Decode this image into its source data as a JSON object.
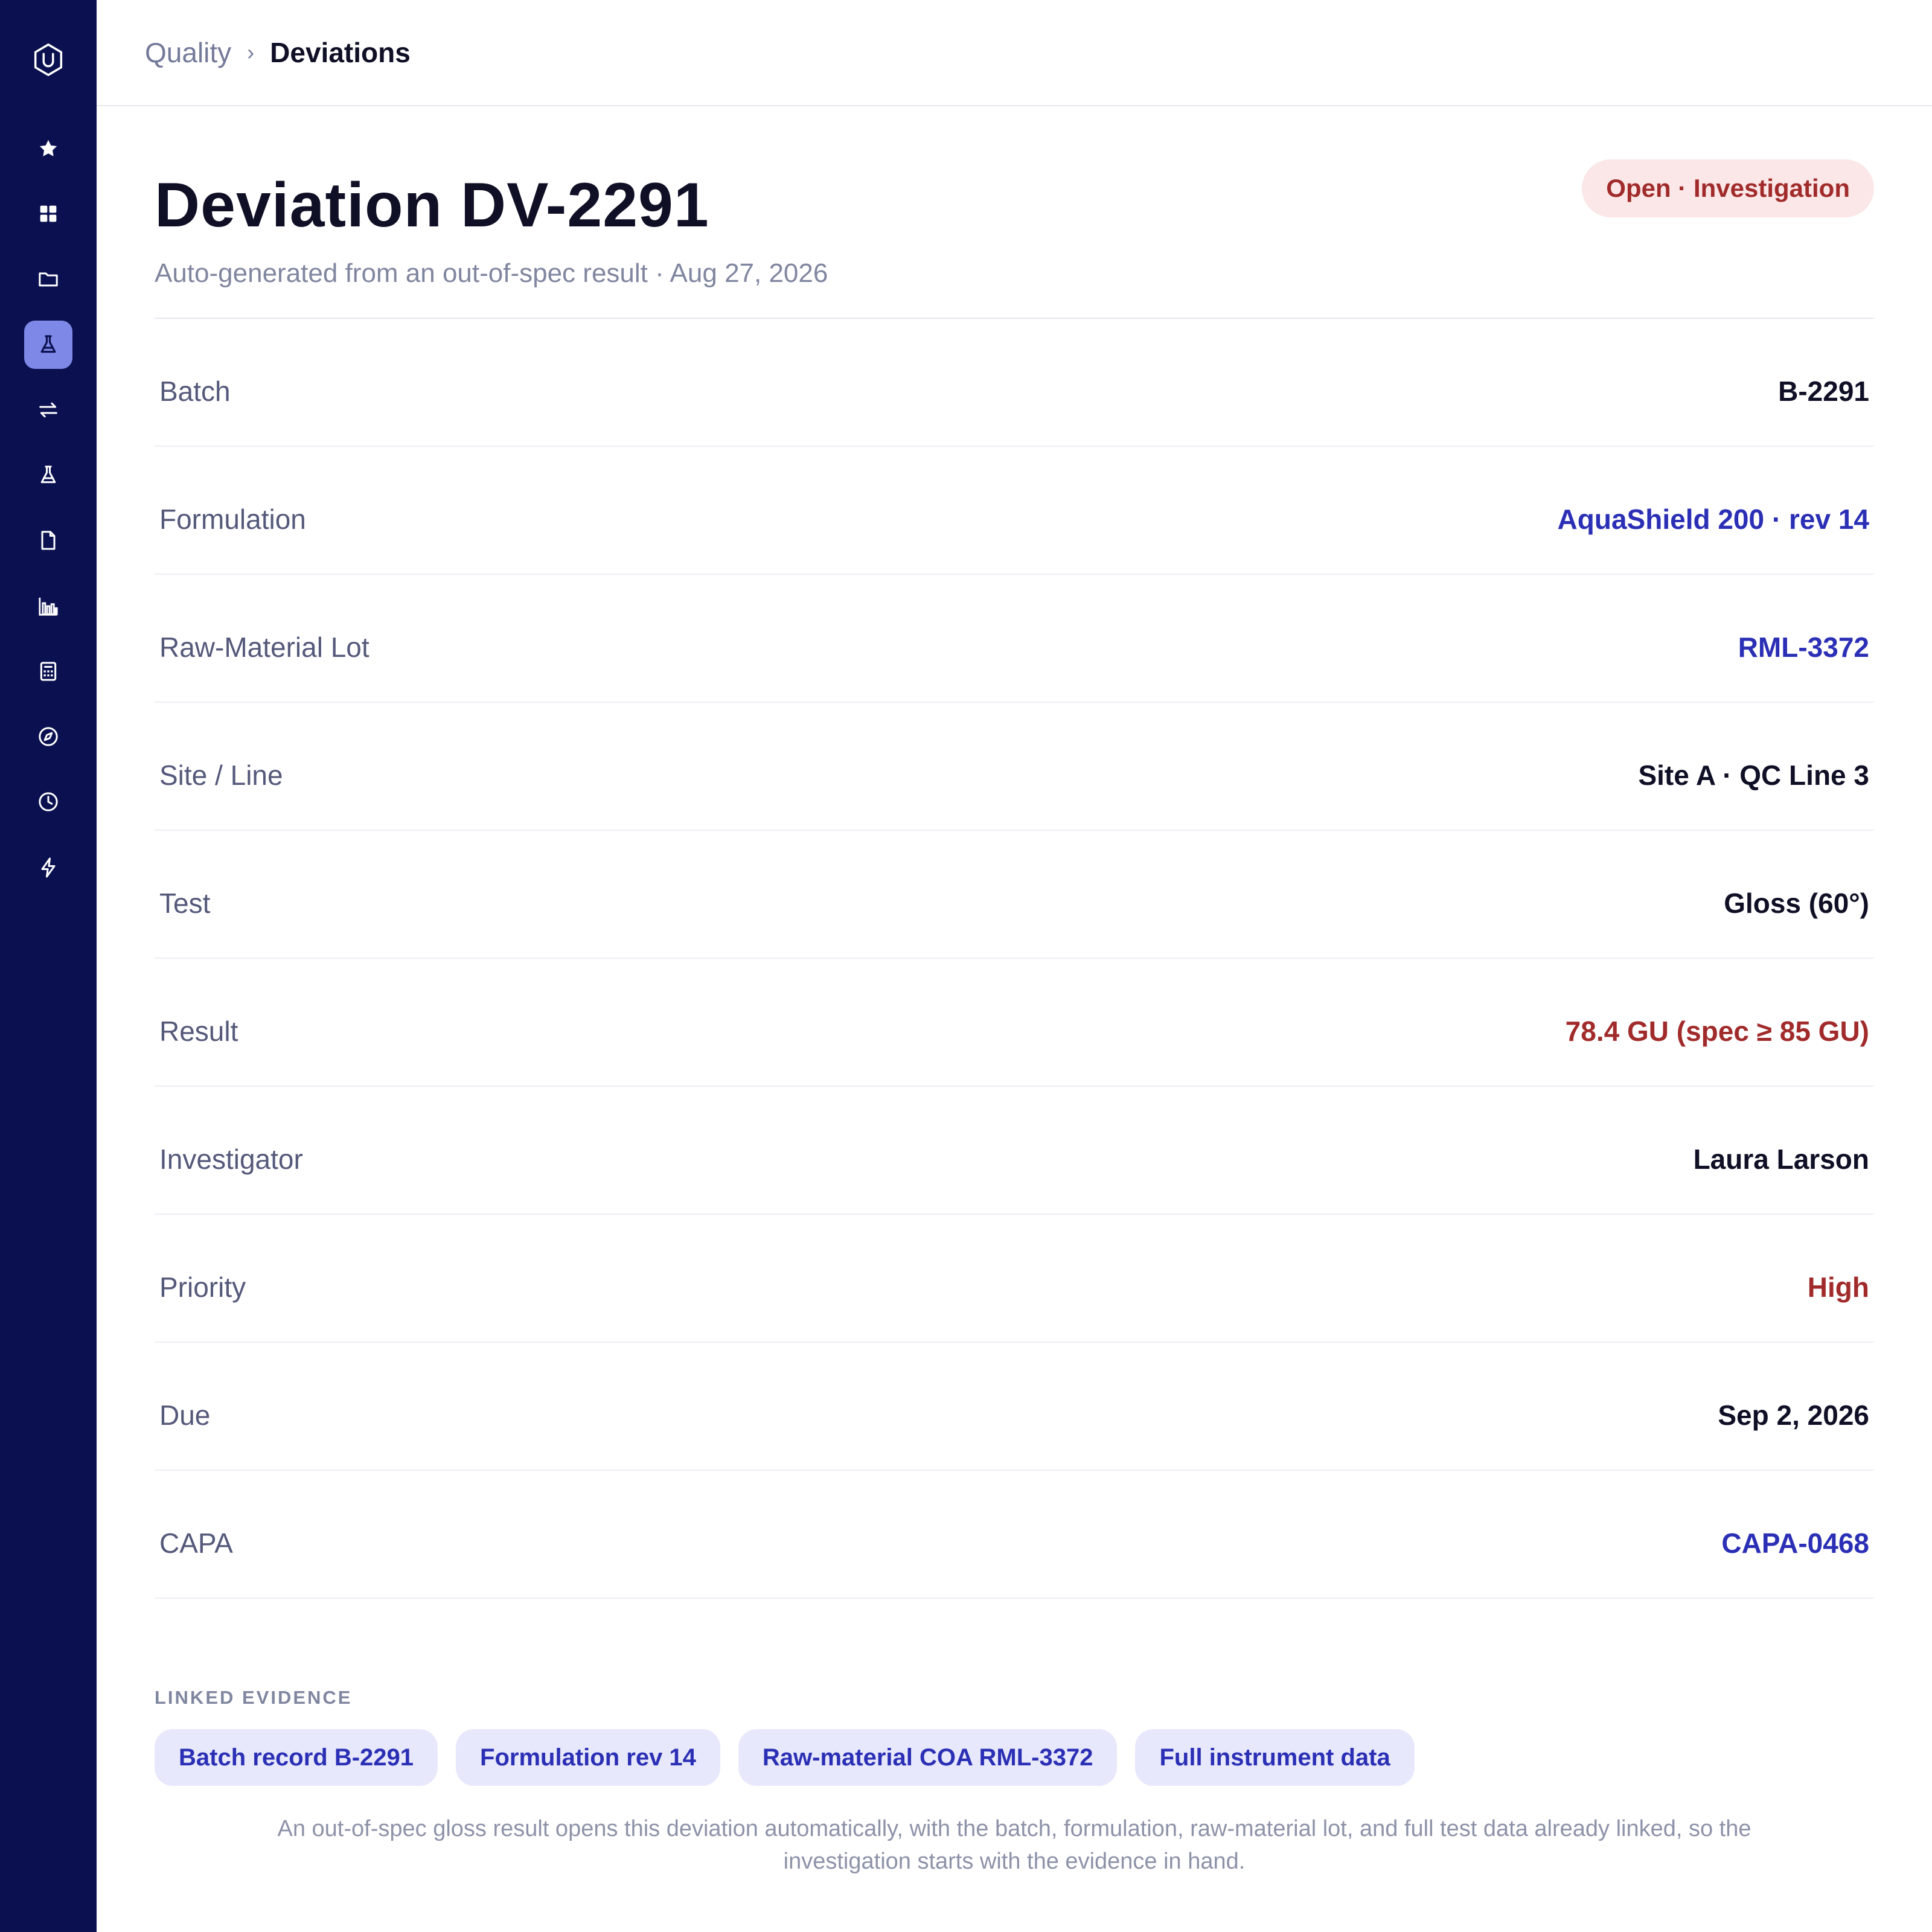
{
  "sidebar": {
    "brand_icon": "shield-u-logo-icon",
    "items": [
      {
        "icon": "star-icon"
      },
      {
        "icon": "grid-icon"
      },
      {
        "icon": "folder-icon"
      },
      {
        "icon": "flask-icon",
        "active": true
      },
      {
        "icon": "swap-arrows-icon"
      },
      {
        "icon": "flask-icon"
      },
      {
        "icon": "document-icon"
      },
      {
        "icon": "bar-chart-icon"
      },
      {
        "icon": "calculator-icon"
      },
      {
        "icon": "compass-icon"
      },
      {
        "icon": "clock-icon"
      },
      {
        "icon": "lightning-icon"
      }
    ]
  },
  "breadcrumb": {
    "parent": "Quality",
    "separator": "›",
    "current": "Deviations"
  },
  "header": {
    "title": "Deviation DV-2291",
    "status": "Open · Investigation",
    "subtitle": "Auto-generated from an out-of-spec result · Aug 27, 2026"
  },
  "fields": [
    {
      "label": "Batch",
      "value": "B-2291",
      "style": "plain"
    },
    {
      "label": "Formulation",
      "value": "AquaShield 200 · rev 14",
      "style": "link"
    },
    {
      "label": "Raw-Material Lot",
      "value": "RML-3372",
      "style": "link"
    },
    {
      "label": "Site / Line",
      "value": "Site A · QC Line 3",
      "style": "plain"
    },
    {
      "label": "Test",
      "value": "Gloss (60°)",
      "style": "plain"
    },
    {
      "label": "Result",
      "value": "78.4 GU (spec ≥ 85 GU)",
      "style": "alert"
    },
    {
      "label": "Investigator",
      "value": "Laura Larson",
      "style": "plain"
    },
    {
      "label": "Priority",
      "value": "High",
      "style": "alert"
    },
    {
      "label": "Due",
      "value": "Sep 2, 2026",
      "style": "plain"
    },
    {
      "label": "CAPA",
      "value": "CAPA-0468",
      "style": "link"
    }
  ],
  "evidence": {
    "heading": "LINKED EVIDENCE",
    "chips": [
      "Batch record B-2291",
      "Formulation rev 14",
      "Raw-material COA RML-3372",
      "Full instrument data"
    ]
  },
  "footnote_line1": "An out-of-spec gloss result opens this deviation automatically, with the batch, formulation, raw-material lot, and full test data already linked, so the",
  "footnote_line2": "investigation starts with the evidence in hand.",
  "colors": {
    "sidebar_bg": "#0b1150",
    "sidebar_active": "#7e88e6",
    "link": "#2b2fb5",
    "alert": "#a12b2b",
    "badge_bg": "#fbe7e7",
    "chip_bg": "#e7e8fb"
  }
}
